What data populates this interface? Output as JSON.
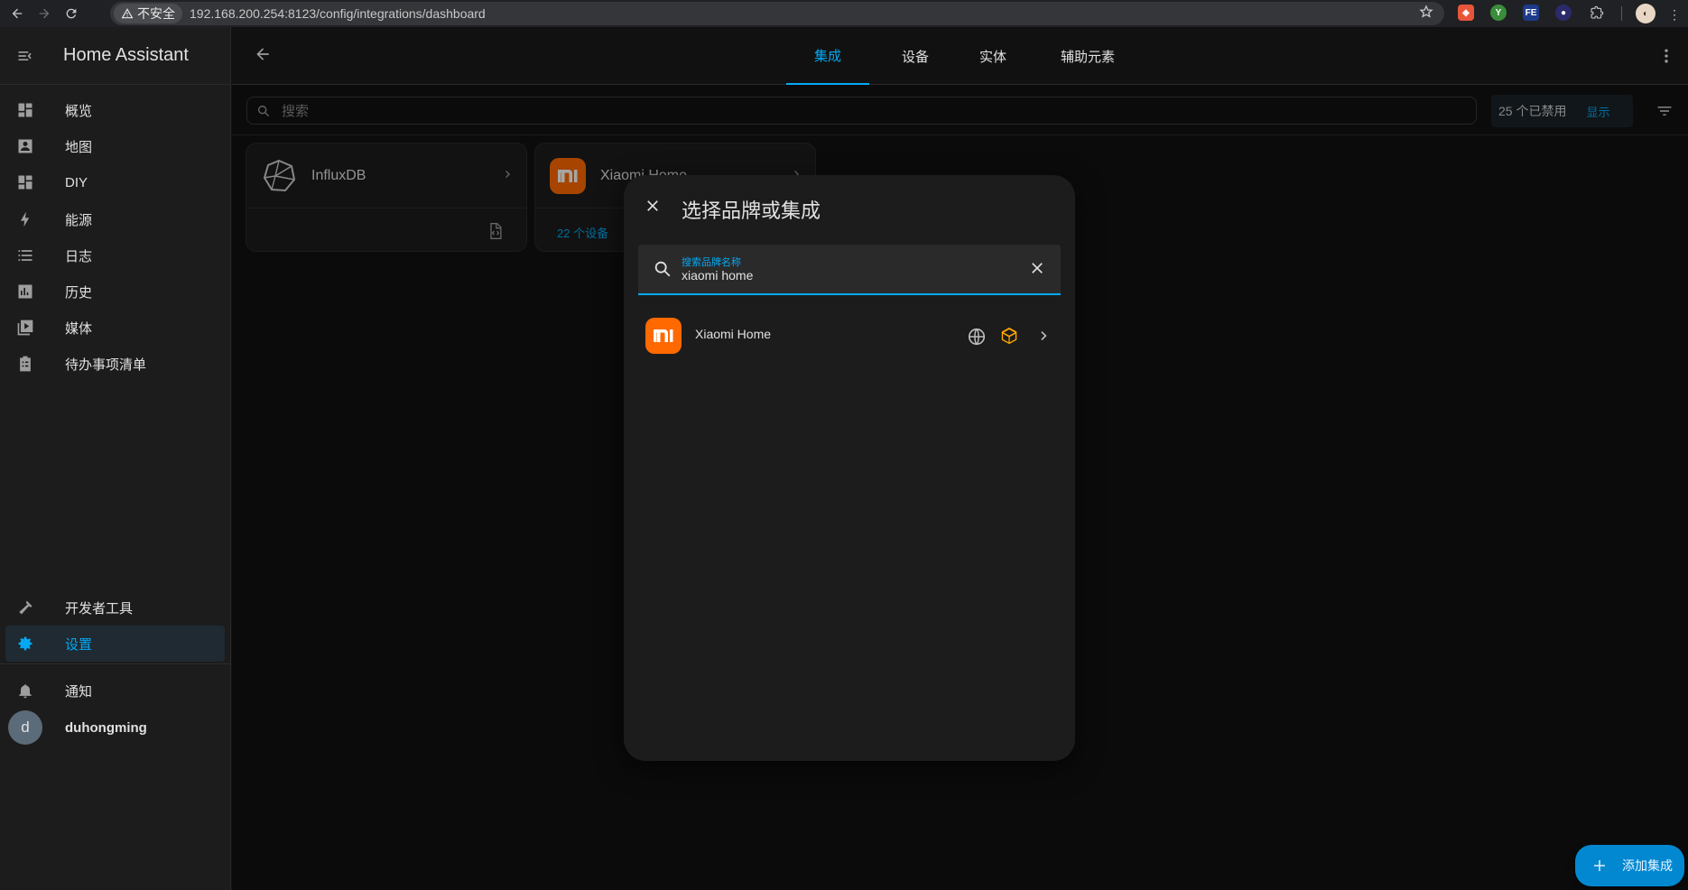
{
  "browser": {
    "security_label": "不安全",
    "url": "192.168.200.254:8123/config/integrations/dashboard"
  },
  "sidebar": {
    "title": "Home Assistant",
    "items": [
      {
        "label": "概览",
        "icon": "dashboard-icon"
      },
      {
        "label": "地图",
        "icon": "map-icon"
      },
      {
        "label": "DIY",
        "icon": "dashboard-icon"
      },
      {
        "label": "能源",
        "icon": "lightning-icon"
      },
      {
        "label": "日志",
        "icon": "list-icon"
      },
      {
        "label": "历史",
        "icon": "chart-icon"
      },
      {
        "label": "媒体",
        "icon": "media-icon"
      },
      {
        "label": "待办事项清单",
        "icon": "clipboard-icon"
      }
    ],
    "dev_tools": "开发者工具",
    "settings": "设置",
    "notifications": "通知",
    "user_initial": "d",
    "user_name": "duhongming"
  },
  "tabs": [
    "集成",
    "设备",
    "实体",
    "辅助元素"
  ],
  "search": {
    "placeholder": "搜索",
    "disabled_count": "25 个已禁用",
    "show_label": "显示"
  },
  "cards": {
    "influx_name": "InfluxDB",
    "xiaomi_name": "Xiaomi Home",
    "xiaomi_devices": "22 个设备"
  },
  "dialog": {
    "title": "选择品牌或集成",
    "field_label": "搜索品牌名称",
    "field_value": "xiaomi home",
    "result_name": "Xiaomi Home"
  },
  "fab_label": "添加集成",
  "colors": {
    "accent": "#03a9f4",
    "xiaomi": "#ff6900",
    "custom_badge": "#ffa600"
  }
}
